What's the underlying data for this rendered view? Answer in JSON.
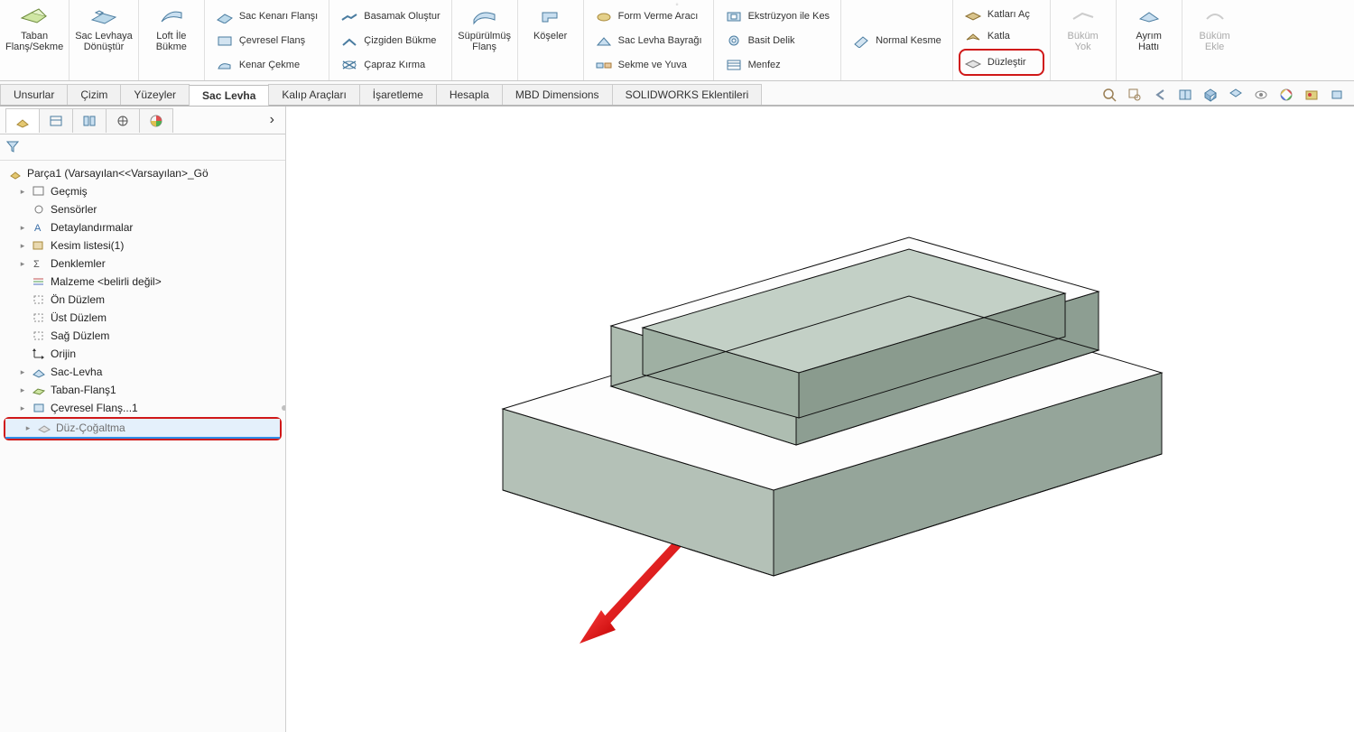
{
  "ribbon": {
    "taban_flans": "Taban\nFlanş/Sekme",
    "sac_levhaya": "Sac Levhaya\nDönüştür",
    "loft_ile": "Loft İle\nBükme",
    "sac_kenari": "Sac Kenarı Flanşı",
    "cevresel_flans": "Çevresel Flanş",
    "kenar_cekme": "Kenar Çekme",
    "basamak": "Basamak Oluştur",
    "cizgiden_bukme": "Çizgiden Bükme",
    "capraz_kirma": "Çapraz Kırma",
    "supurulmus": "Süpürülmüş\nFlanş",
    "koseler": "Köşeler",
    "form_verme": "Form Verme Aracı",
    "sac_levha_bayragi": "Sac Levha Bayrağı",
    "sekme_yuva": "Sekme ve Yuva",
    "ekstruzyon_kes": "Ekstrüzyon ile Kes",
    "basit_delik": "Basit Delik",
    "menfez": "Menfez",
    "normal_kesme": "Normal Kesme",
    "katlari_ac": "Katları Aç",
    "katla": "Katla",
    "duzlestir": "Düzleştir",
    "bukum_yok": "Büküm\nYok",
    "ayrim_hatti": "Ayrım\nHattı",
    "bukum_ekle": "Büküm\nEkle"
  },
  "tabs": {
    "unsurlar": "Unsurlar",
    "cizim": "Çizim",
    "yuzeyler": "Yüzeyler",
    "sac_levha": "Sac Levha",
    "kalip": "Kalıp Araçları",
    "isaretleme": "İşaretleme",
    "hesapla": "Hesapla",
    "mbd": "MBD Dimensions",
    "eklentiler": "SOLIDWORKS Eklentileri"
  },
  "tree": {
    "root": "Parça1  (Varsayılan<<Varsayılan>_Gö",
    "gecmis": "Geçmiş",
    "sensorler": "Sensörler",
    "detay": "Detaylandırmalar",
    "kesim": "Kesim listesi(1)",
    "denklemler": "Denklemler",
    "malzeme": "Malzeme <belirli değil>",
    "on": "Ön Düzlem",
    "ust": "Üst Düzlem",
    "sag": "Sağ Düzlem",
    "orijin": "Orijin",
    "sac_levha": "Sac-Levha",
    "taban_flans": "Taban-Flanş1",
    "cevresel": "Çevresel Flanş...1",
    "duz_cogalt": "Düz-Çoğaltma"
  }
}
